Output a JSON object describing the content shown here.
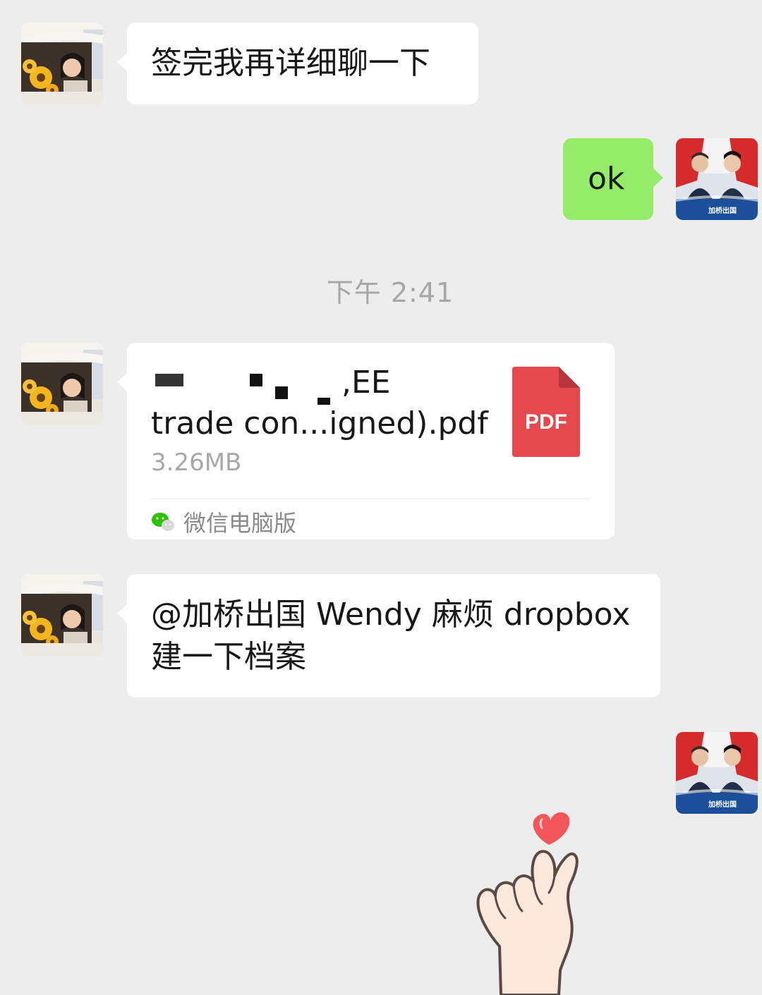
{
  "messages": [
    {
      "sender": "contact",
      "text": "签完我再详细聊一下"
    },
    {
      "sender": "self",
      "text": "ok"
    }
  ],
  "timestamp": "下午 2:41",
  "file_message": {
    "sender": "contact",
    "name_line1_tail": ",EE",
    "name_line2": "trade con...igned).pdf",
    "size": "3.26MB",
    "icon_label": "PDF",
    "source": "微信电脑版",
    "icon_color": "#e5484d"
  },
  "mention_message": {
    "sender": "contact",
    "line1": "@加桥出国 Wendy 麻烦 dropbox",
    "line2": "建一下档案"
  },
  "self_avatar_caption": "加桥出国",
  "colors": {
    "background": "#ededed",
    "self_bubble": "#95ec69",
    "contact_bubble": "#ffffff",
    "timestamp_text": "#a6a6a6"
  }
}
